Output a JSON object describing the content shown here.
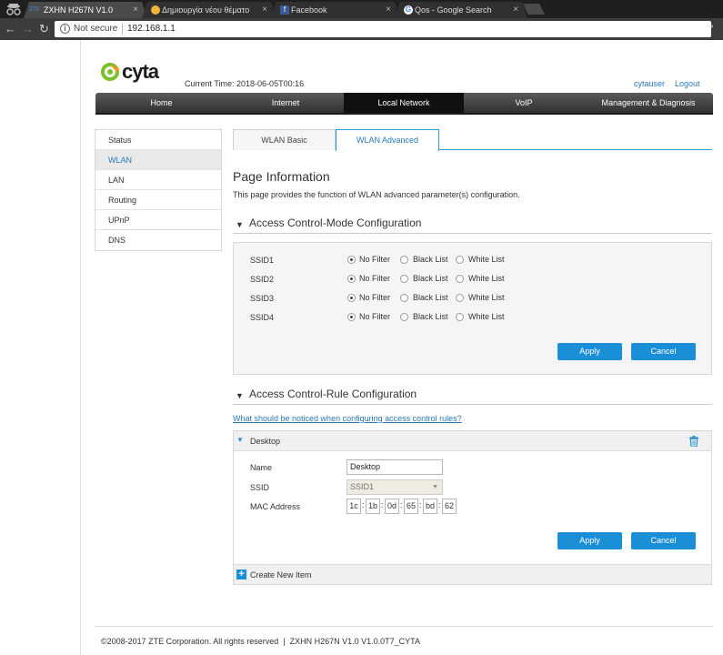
{
  "browser": {
    "tabs": [
      {
        "label": "ZXHN H267N V1.0",
        "favicon_text": "ZTE"
      },
      {
        "label": "Δημιουργία νέου θέματο"
      },
      {
        "label": "Facebook",
        "favicon_text": "f"
      },
      {
        "label": "Qos - Google Search",
        "favicon_text": "G"
      }
    ],
    "close_glyph": "×",
    "security_label": "Not secure",
    "url": "192.168.1.1"
  },
  "header": {
    "logo_text": "cyta",
    "current_time_label": "Current Time:",
    "current_time_value": "2018-06-05T00:16",
    "username": "cytauser",
    "logout": "Logout"
  },
  "main_nav": [
    "Home",
    "Internet",
    "Local Network",
    "VoIP",
    "Management & Diagnosis"
  ],
  "main_nav_active": "Local Network",
  "sidebar": [
    "Status",
    "WLAN",
    "LAN",
    "Routing",
    "UPnP",
    "DNS"
  ],
  "sidebar_active": "WLAN",
  "subtabs": [
    "WLAN Basic",
    "WLAN Advanced"
  ],
  "subtab_active": "WLAN Advanced",
  "page_info": {
    "title": "Page Information",
    "description": "This page provides the function of WLAN advanced parameter(s) configuration."
  },
  "mode_section": {
    "title": "Access Control-Mode Configuration",
    "options": [
      "No Filter",
      "Black List",
      "White List"
    ],
    "rows": [
      {
        "ssid": "SSID1",
        "selected": "No Filter"
      },
      {
        "ssid": "SSID2",
        "selected": "No Filter"
      },
      {
        "ssid": "SSID3",
        "selected": "No Filter"
      },
      {
        "ssid": "SSID4",
        "selected": "No Filter"
      }
    ],
    "apply": "Apply",
    "cancel": "Cancel"
  },
  "rule_section": {
    "title": "Access Control-Rule Configuration",
    "help_link": "What should be noticed when configuring access control rules?",
    "rule": {
      "name_header": "Desktop",
      "name_label": "Name",
      "name_value": "Desktop",
      "ssid_label": "SSID",
      "ssid_value": "SSID1",
      "mac_label": "MAC Address",
      "mac_octets": [
        "1c",
        "1b",
        "0d",
        "65",
        "bd",
        "62"
      ]
    },
    "apply": "Apply",
    "cancel": "Cancel",
    "create_new": "Create New Item"
  },
  "footer": {
    "copyright": "©2008-2017 ZTE Corporation. All rights reserved",
    "separator": "|",
    "version": "ZXHN H267N V1.0 V1.0.0T7_CYTA"
  },
  "colors": {
    "accent": "#1a8fd8",
    "link": "#2a7ab8",
    "nav_dark": "#2d2d2d"
  },
  "icons": [
    "incognito-icon",
    "back-icon",
    "forward-icon",
    "reload-icon",
    "info-icon",
    "key-icon",
    "trash-icon",
    "plus-icon",
    "collapse-triangle-icon"
  ]
}
